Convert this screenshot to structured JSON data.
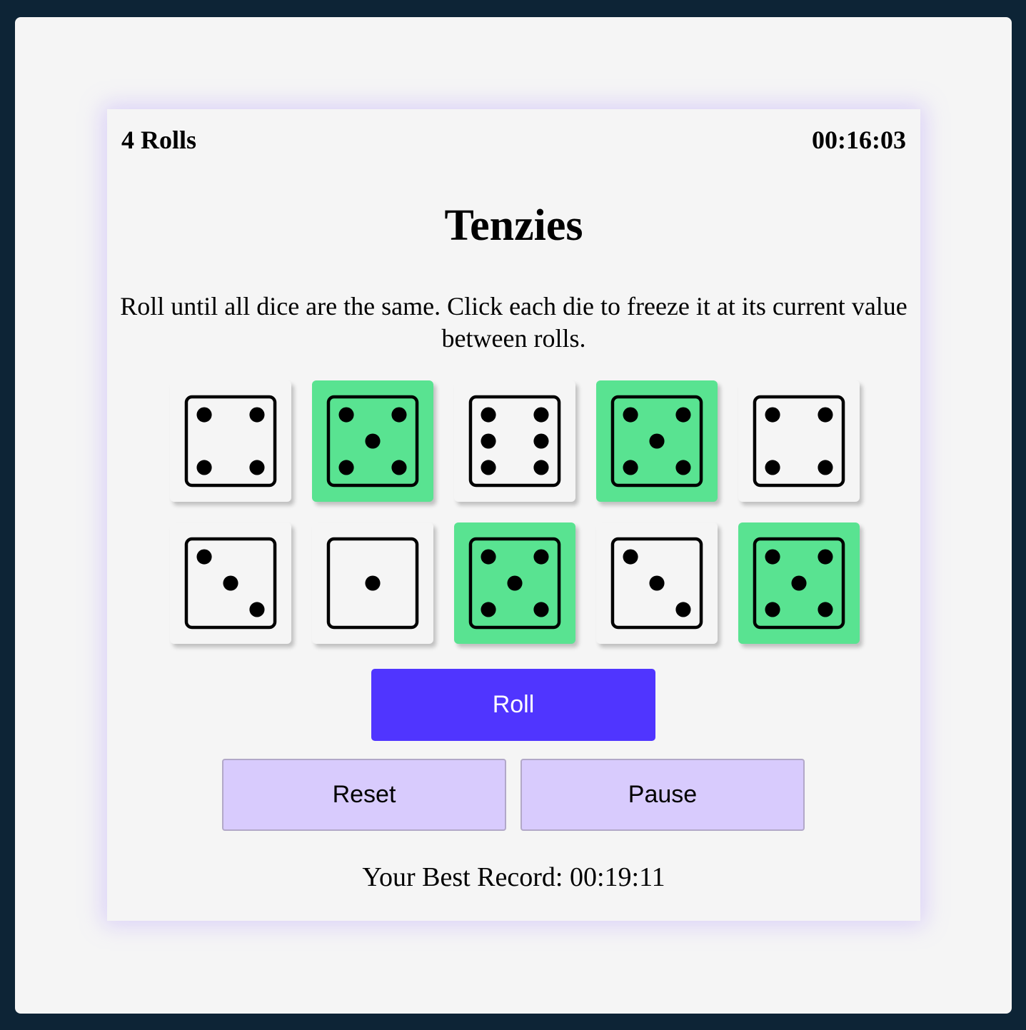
{
  "header": {
    "rolls_label": "4 Rolls",
    "timer": "00:16:03"
  },
  "title": "Tenzies",
  "instructions": "Roll until all dice are the same. Click each die to freeze it at its current value between rolls.",
  "dice": [
    {
      "value": 4,
      "held": false
    },
    {
      "value": 5,
      "held": true
    },
    {
      "value": 6,
      "held": false
    },
    {
      "value": 5,
      "held": true
    },
    {
      "value": 4,
      "held": false
    },
    {
      "value": 3,
      "held": false
    },
    {
      "value": 1,
      "held": false
    },
    {
      "value": 5,
      "held": true
    },
    {
      "value": 3,
      "held": false
    },
    {
      "value": 5,
      "held": true
    }
  ],
  "buttons": {
    "roll": "Roll",
    "reset": "Reset",
    "pause": "Pause"
  },
  "best_record": "Your Best Record: 00:19:11",
  "colors": {
    "held": "#59e391",
    "roll_button": "#5035ff",
    "secondary_button": "#d8cbfd",
    "background": "#0d2436"
  }
}
